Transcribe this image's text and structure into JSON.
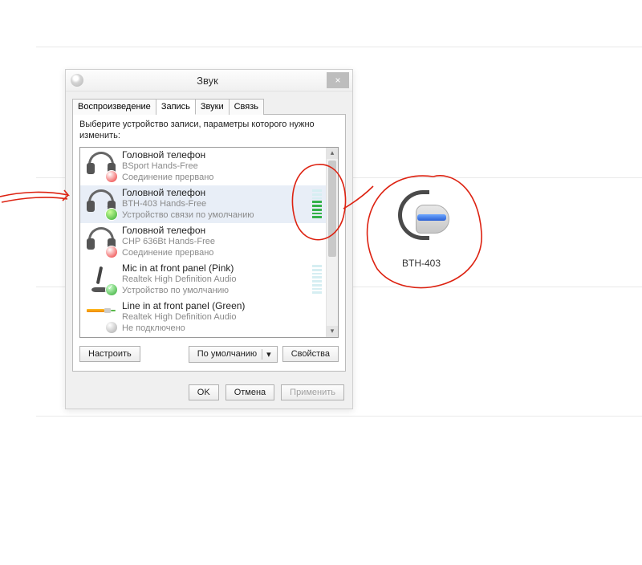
{
  "dialog": {
    "title": "Звук",
    "tabs": {
      "playback": "Воспроизведение",
      "recording": "Запись",
      "sounds": "Звуки",
      "communication": "Связь"
    },
    "active_tab": "recording",
    "instruction": "Выберите устройство записи, параметры которого нужно изменить:",
    "buttons": {
      "configure": "Настроить",
      "default": "По умолчанию",
      "properties": "Свойства",
      "ok": "OK",
      "cancel": "Отмена",
      "apply": "Применить"
    }
  },
  "devices": [
    {
      "name": "Головной телефон",
      "subtitle": "BSport Hands-Free",
      "status": "Соединение прервано",
      "icon": "headset",
      "badge": "red",
      "selected": false,
      "level_bars": 0,
      "show_meter": false
    },
    {
      "name": "Головной телефон",
      "subtitle": "BTH-403 Hands-Free",
      "status": "Устройство связи по умолчанию",
      "icon": "headset",
      "badge": "green-phone",
      "selected": true,
      "level_bars": 5,
      "show_meter": true
    },
    {
      "name": "Головной телефон",
      "subtitle": "CHP 636Bt Hands-Free",
      "status": "Соединение прервано",
      "icon": "headset",
      "badge": "red",
      "selected": false,
      "level_bars": 0,
      "show_meter": false
    },
    {
      "name": "Mic in at front panel (Pink)",
      "subtitle": "Realtek High Definition Audio",
      "status": "Устройство по умолчанию",
      "icon": "mic",
      "badge": "green-check",
      "selected": false,
      "level_bars": 0,
      "show_meter": true
    },
    {
      "name": "Line in at front panel (Green)",
      "subtitle": "Realtek High Definition Audio",
      "status": "Не подключено",
      "icon": "linein",
      "badge": "gray",
      "selected": false,
      "level_bars": 0,
      "show_meter": false
    }
  ],
  "external_device": {
    "label": "BTH-403"
  }
}
